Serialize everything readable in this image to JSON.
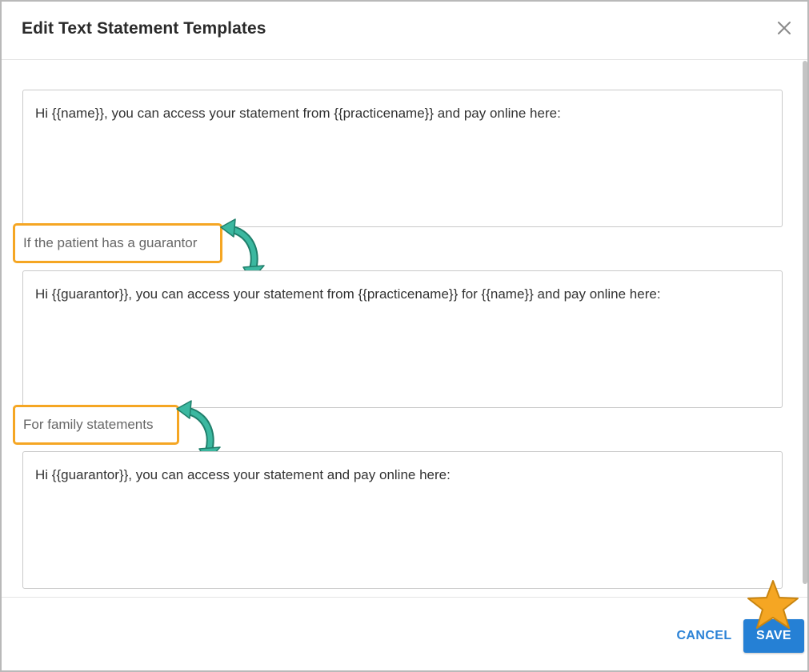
{
  "dialog": {
    "title": "Edit Text Statement Templates",
    "close_icon": "close-icon"
  },
  "templates": [
    {
      "value": "Hi {{name}}, you can access your statement from {{practicename}} and pay online here:"
    },
    {
      "value": "Hi {{guarantor}}, you can access your statement from {{practicename}} for {{name}} and pay online here:"
    },
    {
      "value": "Hi {{guarantor}}, you can access your statement and pay online here:"
    }
  ],
  "callouts": {
    "guarantor": "If the patient has a guarantor",
    "family": "For family statements"
  },
  "footer": {
    "cancel_label": "CANCEL",
    "save_label": "SAVE"
  },
  "colors": {
    "accent": "#2580d5",
    "callout_border": "#f5a623",
    "arrow": "#3bb8a0",
    "star": "#f5a623"
  }
}
